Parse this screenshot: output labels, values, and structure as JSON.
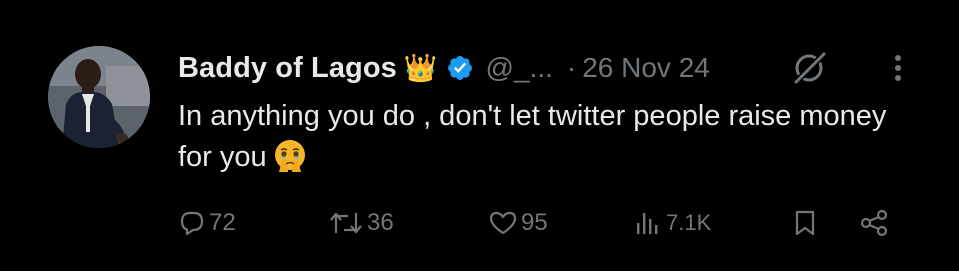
{
  "tweet": {
    "display_name": "Baddy of Lagos",
    "name_emoji": "👑",
    "handle": "@_...",
    "separator": "·",
    "date": "26 Nov 24",
    "text": "In anything you do , don't let twitter people raise money for you",
    "text_emoji": "face-holding-back-tears",
    "verified": true,
    "verified_color": "#1d9bf0"
  },
  "actions": {
    "replies": "72",
    "retweets": "36",
    "likes": "95",
    "views": "7.1K"
  },
  "icons": {
    "header": [
      "crown-emoji",
      "verified-badge-icon",
      "grok-icon",
      "more-icon"
    ],
    "actions": [
      "reply-icon",
      "retweet-icon",
      "like-icon",
      "views-icon",
      "bookmark-icon",
      "share-icon"
    ]
  },
  "colors": {
    "background": "#000000",
    "primary_text": "#e7e9ea",
    "secondary_text": "#71767b",
    "accent_blue": "#1d9bf0"
  }
}
